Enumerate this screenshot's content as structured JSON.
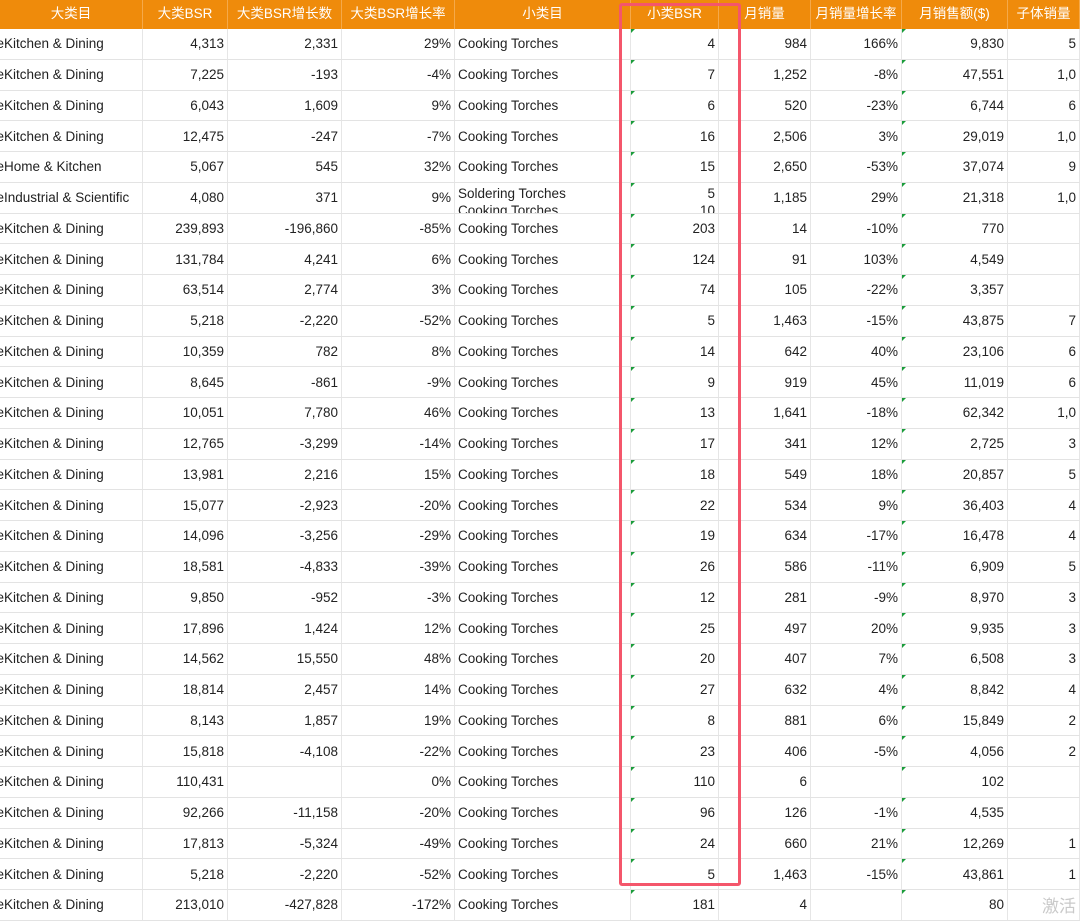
{
  "header": {
    "columns": [
      "大类目",
      "大类BSR",
      "大类BSR增长数",
      "大类BSR增长率",
      "小类目",
      "小类BSR",
      "月销量",
      "月销量增长率",
      "月销售额($)",
      "子体销量"
    ]
  },
  "table": {
    "rows": [
      [
        "Kitchen & Dining",
        "4,313",
        "2,331",
        "29%",
        "Cooking Torches",
        "4",
        "984",
        "166%",
        "9,830",
        "5"
      ],
      [
        "Kitchen & Dining",
        "7,225",
        "-193",
        "-4%",
        "Cooking Torches",
        "7",
        "1,252",
        "-8%",
        "47,551",
        "1,0"
      ],
      [
        "Kitchen & Dining",
        "6,043",
        "1,609",
        "9%",
        "Cooking Torches",
        "6",
        "520",
        "-23%",
        "6,744",
        "6"
      ],
      [
        "Kitchen & Dining",
        "12,475",
        "-247",
        "-7%",
        "Cooking Torches",
        "16",
        "2,506",
        "3%",
        "29,019",
        "1,0"
      ],
      [
        "Home & Kitchen",
        "5,067",
        "545",
        "32%",
        "Cooking Torches",
        "15",
        "2,650",
        "-53%",
        "37,074",
        "9"
      ],
      [
        "Industrial & Scientific",
        "4,080",
        "371",
        "9%",
        "Soldering Torches|Cooking Torches",
        "5|10",
        "1,185",
        "29%",
        "21,318",
        "1,0"
      ],
      [
        "Kitchen & Dining",
        "239,893",
        "-196,860",
        "-85%",
        "Cooking Torches",
        "203",
        "14",
        "-10%",
        "770",
        ""
      ],
      [
        "Kitchen & Dining",
        "131,784",
        "4,241",
        "6%",
        "Cooking Torches",
        "124",
        "91",
        "103%",
        "4,549",
        ""
      ],
      [
        "Kitchen & Dining",
        "63,514",
        "2,774",
        "3%",
        "Cooking Torches",
        "74",
        "105",
        "-22%",
        "3,357",
        ""
      ],
      [
        "Kitchen & Dining",
        "5,218",
        "-2,220",
        "-52%",
        "Cooking Torches",
        "5",
        "1,463",
        "-15%",
        "43,875",
        "7"
      ],
      [
        "Kitchen & Dining",
        "10,359",
        "782",
        "8%",
        "Cooking Torches",
        "14",
        "642",
        "40%",
        "23,106",
        "6"
      ],
      [
        "Kitchen & Dining",
        "8,645",
        "-861",
        "-9%",
        "Cooking Torches",
        "9",
        "919",
        "45%",
        "11,019",
        "6"
      ],
      [
        "Kitchen & Dining",
        "10,051",
        "7,780",
        "46%",
        "Cooking Torches",
        "13",
        "1,641",
        "-18%",
        "62,342",
        "1,0"
      ],
      [
        "Kitchen & Dining",
        "12,765",
        "-3,299",
        "-14%",
        "Cooking Torches",
        "17",
        "341",
        "12%",
        "2,725",
        "3"
      ],
      [
        "Kitchen & Dining",
        "13,981",
        "2,216",
        "15%",
        "Cooking Torches",
        "18",
        "549",
        "18%",
        "20,857",
        "5"
      ],
      [
        "Kitchen & Dining",
        "15,077",
        "-2,923",
        "-20%",
        "Cooking Torches",
        "22",
        "534",
        "9%",
        "36,403",
        "4"
      ],
      [
        "Kitchen & Dining",
        "14,096",
        "-3,256",
        "-29%",
        "Cooking Torches",
        "19",
        "634",
        "-17%",
        "16,478",
        "4"
      ],
      [
        "Kitchen & Dining",
        "18,581",
        "-4,833",
        "-39%",
        "Cooking Torches",
        "26",
        "586",
        "-11%",
        "6,909",
        "5"
      ],
      [
        "Kitchen & Dining",
        "9,850",
        "-952",
        "-3%",
        "Cooking Torches",
        "12",
        "281",
        "-9%",
        "8,970",
        "3"
      ],
      [
        "Kitchen & Dining",
        "17,896",
        "1,424",
        "12%",
        "Cooking Torches",
        "25",
        "497",
        "20%",
        "9,935",
        "3"
      ],
      [
        "Kitchen & Dining",
        "14,562",
        "15,550",
        "48%",
        "Cooking Torches",
        "20",
        "407",
        "7%",
        "6,508",
        "3"
      ],
      [
        "Kitchen & Dining",
        "18,814",
        "2,457",
        "14%",
        "Cooking Torches",
        "27",
        "632",
        "4%",
        "8,842",
        "4"
      ],
      [
        "Kitchen & Dining",
        "8,143",
        "1,857",
        "19%",
        "Cooking Torches",
        "8",
        "881",
        "6%",
        "15,849",
        "2"
      ],
      [
        "Kitchen & Dining",
        "15,818",
        "-4,108",
        "-22%",
        "Cooking Torches",
        "23",
        "406",
        "-5%",
        "4,056",
        "2"
      ],
      [
        "Kitchen & Dining",
        "110,431",
        "",
        "0%",
        "Cooking Torches",
        "110",
        "6",
        "",
        "102",
        ""
      ],
      [
        "Kitchen & Dining",
        "92,266",
        "-11,158",
        "-20%",
        "Cooking Torches",
        "96",
        "126",
        "-1%",
        "4,535",
        ""
      ],
      [
        "Kitchen & Dining",
        "17,813",
        "-5,324",
        "-49%",
        "Cooking Torches",
        "24",
        "660",
        "21%",
        "12,269",
        "1"
      ],
      [
        "Kitchen & Dining",
        "5,218",
        "-2,220",
        "-52%",
        "Cooking Torches",
        "5",
        "1,463",
        "-15%",
        "43,861",
        "1"
      ],
      [
        "Kitchen & Dining",
        "213,010",
        "-427,828",
        "-172%",
        "Cooking Torches",
        "181",
        "4",
        "",
        "80",
        ""
      ]
    ]
  },
  "watermark": "激活",
  "colors": {
    "header_bg": "#ef8b0b",
    "selection_border": "#f4566b",
    "cell_marker": "#1a9c3a"
  }
}
